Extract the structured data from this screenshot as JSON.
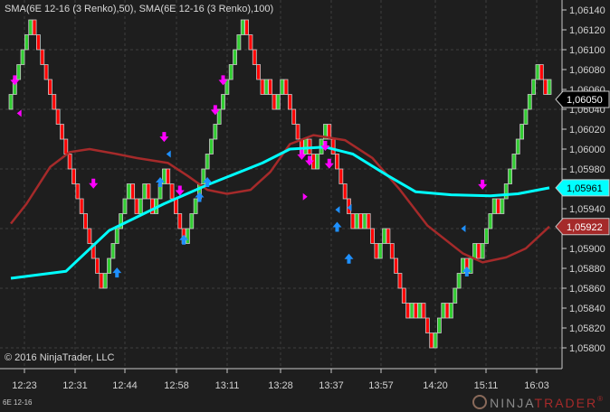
{
  "header": {
    "indicator_title": "SMA(6E 12-16 (3 Renko),50), SMA(6E 12-16 (3 Renko),100)"
  },
  "footer": {
    "copyright": "© 2016 NinjaTrader, LLC",
    "instrument": "6E 12-16",
    "logo_ninja": "NINJA",
    "logo_trader": "TRADER",
    "logo_reg": "®"
  },
  "colors": {
    "background": "#1e1e1e",
    "up": "#32cd32",
    "down": "#ff0000",
    "sma50": "#00ffff",
    "sma100": "#a52a2a",
    "marker_short": "#ff00ff",
    "marker_long": "#1e90ff"
  },
  "chart_data": {
    "type": "renko",
    "brick_size": 0.00015,
    "price_axis": {
      "min": 1.058,
      "max": 1.0614,
      "ticks": [
        "1,06140",
        "1,06120",
        "1,06100",
        "1,06080",
        "1,06060",
        "1,06040",
        "1,06020",
        "1,06000",
        "1,05980",
        "1,05960",
        "1,05940",
        "1,05920",
        "1,05900",
        "1,05880",
        "1,05860",
        "1,05840",
        "1,05820",
        "1,05800"
      ]
    },
    "time_labels": [
      "12:23",
      "12:31",
      "12:44",
      "12:58",
      "13:11",
      "13:28",
      "13:37",
      "13:57",
      "14:20",
      "15:11",
      "16:03"
    ],
    "brick_pivot_levels": [
      16,
      22,
      4,
      11,
      9,
      11,
      9,
      12,
      7,
      22,
      17,
      18,
      16,
      18,
      13,
      14,
      12,
      15,
      8,
      9,
      8,
      9,
      6,
      8,
      2,
      3,
      2,
      3,
      0,
      3,
      2,
      6,
      5,
      7,
      6,
      10,
      9,
      19,
      17,
      18
    ],
    "last_price": {
      "value": 1.0605,
      "label": "1,06050"
    },
    "sma50": {
      "name": "SMA 50",
      "label": "1,05961",
      "points": [
        [
          0,
          1.0587
        ],
        [
          14,
          1.05877
        ],
        [
          25,
          1.05918
        ],
        [
          39,
          1.05945
        ],
        [
          50,
          1.05964
        ],
        [
          64,
          1.05986
        ],
        [
          71,
          1.06
        ],
        [
          80,
          1.06002
        ],
        [
          87,
          1.05995
        ],
        [
          96,
          1.05973
        ],
        [
          103,
          1.05957
        ],
        [
          112,
          1.05954
        ],
        [
          122,
          1.05953
        ],
        [
          129,
          1.05955
        ],
        [
          137,
          1.05961
        ]
      ]
    },
    "sma100": {
      "name": "SMA 100",
      "label": "1,05922",
      "points": [
        [
          0,
          1.05925
        ],
        [
          4,
          1.05945
        ],
        [
          10,
          1.05982
        ],
        [
          15,
          1.05997
        ],
        [
          20,
          1.06
        ],
        [
          27,
          1.05995
        ],
        [
          32,
          1.05991
        ],
        [
          40,
          1.05986
        ],
        [
          45,
          1.05973
        ],
        [
          50,
          1.05959
        ],
        [
          55,
          1.05955
        ],
        [
          61,
          1.05959
        ],
        [
          66,
          1.05977
        ],
        [
          71,
          1.06005
        ],
        [
          77,
          1.06014
        ],
        [
          85,
          1.06009
        ],
        [
          92,
          1.05991
        ],
        [
          99,
          1.05959
        ],
        [
          106,
          1.05923
        ],
        [
          115,
          1.05895
        ],
        [
          120,
          1.05886
        ],
        [
          126,
          1.05891
        ],
        [
          131,
          1.059
        ],
        [
          137,
          1.05922
        ]
      ]
    },
    "markers": [
      {
        "type": "short-arrow",
        "bar": 1,
        "price": 1.06066
      },
      {
        "type": "short-arrow",
        "bar": 21,
        "price": 1.05962
      },
      {
        "type": "short-arrow",
        "bar": 39,
        "price": 1.06009
      },
      {
        "type": "short-arrow",
        "bar": 43,
        "price": 1.05955
      },
      {
        "type": "short-arrow",
        "bar": 52,
        "price": 1.06036
      },
      {
        "type": "short-arrow",
        "bar": 54,
        "price": 1.06066
      },
      {
        "type": "short-arrow",
        "bar": 74,
        "price": 1.05991
      },
      {
        "type": "short-arrow",
        "bar": 76,
        "price": 1.05985
      },
      {
        "type": "short-arrow",
        "bar": 80,
        "price": 1.06
      },
      {
        "type": "short-arrow",
        "bar": 81,
        "price": 1.05982
      },
      {
        "type": "short-arrow",
        "bar": 120,
        "price": 1.05961
      },
      {
        "type": "long-arrow",
        "bar": 27,
        "price": 1.05879
      },
      {
        "type": "long-arrow",
        "bar": 38,
        "price": 1.0597
      },
      {
        "type": "long-arrow",
        "bar": 44,
        "price": 1.05912
      },
      {
        "type": "long-arrow",
        "bar": 48,
        "price": 1.05955
      },
      {
        "type": "long-arrow",
        "bar": 50,
        "price": 1.0597
      },
      {
        "type": "long-arrow",
        "bar": 83,
        "price": 1.05925
      },
      {
        "type": "long-arrow",
        "bar": 86,
        "price": 1.05893
      },
      {
        "type": "long-arrow",
        "bar": 116,
        "price": 1.0588
      },
      {
        "type": "short-exit",
        "bar": 2,
        "price": 1.06036
      },
      {
        "type": "long-exit",
        "bar": 40,
        "price": 1.05995
      },
      {
        "type": "long-exit",
        "bar": 83,
        "price": 1.05939
      },
      {
        "type": "long-exit",
        "bar": 86,
        "price": 1.05941
      },
      {
        "type": "short-entry-tri",
        "bar": 75,
        "price": 1.05952
      },
      {
        "type": "long-exit",
        "bar": 115,
        "price": 1.0592
      }
    ]
  }
}
